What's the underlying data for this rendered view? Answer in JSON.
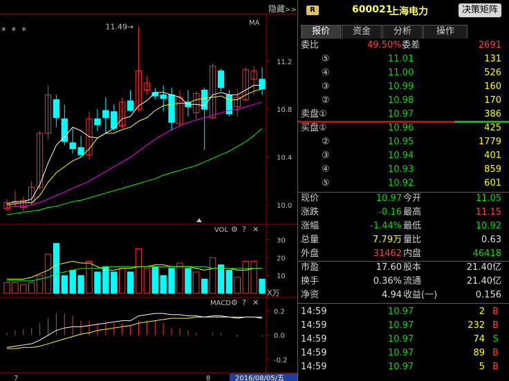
{
  "header": {
    "hide_label": "隐藏",
    "hide_arrow": ">>",
    "r_badge": "R",
    "stock_code": "600021",
    "stock_name": "上海电力",
    "decision_button": "决策矩阵"
  },
  "tabs": [
    {
      "label": "报价",
      "active": true
    },
    {
      "label": "资金",
      "active": false
    },
    {
      "label": "分析",
      "active": false
    },
    {
      "label": "操作",
      "active": false
    }
  ],
  "weibi": {
    "label1": "委比",
    "value1": "49.50%",
    "label2": "委差",
    "value2": "2691"
  },
  "asks": [
    {
      "label": "⑤",
      "price": "11.01",
      "vol": "131"
    },
    {
      "label": "④",
      "price": "11.00",
      "vol": "526"
    },
    {
      "label": "③",
      "price": "10.99",
      "vol": "160"
    },
    {
      "label": "②",
      "price": "10.98",
      "vol": "170"
    },
    {
      "label": "卖盘①",
      "price": "10.97",
      "vol": "386"
    }
  ],
  "bids": [
    {
      "label": "买盘①",
      "price": "10.96",
      "vol": "425"
    },
    {
      "label": "②",
      "price": "10.95",
      "vol": "1779"
    },
    {
      "label": "③",
      "price": "10.94",
      "vol": "401"
    },
    {
      "label": "④",
      "price": "10.93",
      "vol": "859"
    },
    {
      "label": "⑤",
      "price": "10.92",
      "vol": "601"
    }
  ],
  "quote": [
    {
      "l1": "现价",
      "v1": "10.97",
      "c1": "g",
      "l2": "今开",
      "v2": "11.05",
      "c2": "g"
    },
    {
      "l1": "涨跌",
      "v1": "-0.16",
      "c1": "g",
      "l2": "最高",
      "v2": "11.15",
      "c2": "r"
    },
    {
      "l1": "涨幅",
      "v1": "-1.44%",
      "c1": "g",
      "l2": "最低",
      "v2": "10.92",
      "c2": "g"
    },
    {
      "l1": "总量",
      "v1": "7.79万",
      "c1": "y",
      "l2": "量比",
      "v2": "0.63",
      "c2": "w"
    },
    {
      "l1": "外盘",
      "v1": "31462",
      "c1": "r",
      "l2": "内盘",
      "v2": "46418",
      "c2": "g"
    }
  ],
  "fundamentals": [
    {
      "l1": "市盈",
      "v1": "17.60",
      "l2": "股本",
      "v2": "21.40亿"
    },
    {
      "l1": "换手",
      "v1": "0.36%",
      "l2": "流通",
      "v2": "21.40亿"
    },
    {
      "l1": "净资",
      "v1": "4.94",
      "l2": "收益(一)",
      "v2": "0.156"
    }
  ],
  "trades": [
    {
      "time": "14:59",
      "price": "10.97",
      "vol": "2",
      "side": "B"
    },
    {
      "time": "14:59",
      "price": "10.97",
      "vol": "232",
      "side": "B"
    },
    {
      "time": "14:59",
      "price": "10.97",
      "vol": "74",
      "side": "S"
    },
    {
      "time": "14:59",
      "price": "10.97",
      "vol": "89",
      "side": "B"
    },
    {
      "time": "14:59",
      "price": "10.97",
      "vol": "5",
      "side": "B"
    }
  ],
  "chart_header": {
    "stars": "* * *",
    "ma_label": "MA",
    "high_annotation": "11.49"
  },
  "vol_panel": {
    "label": "VOL",
    "unit": "X万",
    "ticks": [
      "30",
      "20",
      "10"
    ]
  },
  "macd_panel": {
    "label": "MACD",
    "ticks": [
      "0.2",
      "0.0",
      "-0.2"
    ]
  },
  "price_ticks": [
    "11.2",
    "10.8",
    "10.4",
    "10.0"
  ],
  "x_axis": {
    "label_a": "7",
    "label_b": "8",
    "date": "2016/08/05/五"
  },
  "colors": {
    "up": "#ff3030",
    "down": "#00ffff",
    "ma5": "#ffffff",
    "ma10": "#ffff00",
    "ma20": "#ff00ff",
    "ma60": "#00ff00"
  },
  "chart_data": {
    "type": "candlestick",
    "price_range": [
      9.88,
      11.55
    ],
    "candles": [
      {
        "o": 9.97,
        "h": 10.05,
        "l": 9.95,
        "c": 10.02
      },
      {
        "o": 10.02,
        "h": 10.12,
        "l": 9.98,
        "c": 10.03
      },
      {
        "o": 9.98,
        "h": 10.07,
        "l": 9.95,
        "c": 10.04
      },
      {
        "o": 10.02,
        "h": 10.2,
        "l": 10.0,
        "c": 10.15
      },
      {
        "o": 10.15,
        "h": 10.62,
        "l": 10.13,
        "c": 10.6
      },
      {
        "o": 10.6,
        "h": 11.0,
        "l": 10.55,
        "c": 10.92
      },
      {
        "o": 10.88,
        "h": 10.92,
        "l": 10.65,
        "c": 10.73
      },
      {
        "o": 10.72,
        "h": 10.84,
        "l": 10.5,
        "c": 10.53
      },
      {
        "o": 10.52,
        "h": 10.64,
        "l": 10.43,
        "c": 10.47
      },
      {
        "o": 10.48,
        "h": 10.58,
        "l": 10.4,
        "c": 10.42
      },
      {
        "o": 10.42,
        "h": 10.78,
        "l": 10.38,
        "c": 10.72
      },
      {
        "o": 10.72,
        "h": 10.8,
        "l": 10.62,
        "c": 10.67
      },
      {
        "o": 10.79,
        "h": 10.9,
        "l": 10.6,
        "c": 10.73
      },
      {
        "o": 10.78,
        "h": 10.84,
        "l": 10.62,
        "c": 10.64
      },
      {
        "o": 10.66,
        "h": 10.9,
        "l": 10.64,
        "c": 10.86
      },
      {
        "o": 10.87,
        "h": 10.96,
        "l": 10.78,
        "c": 10.79
      },
      {
        "o": 10.8,
        "h": 11.49,
        "l": 10.78,
        "c": 11.12
      },
      {
        "o": 10.96,
        "h": 11.08,
        "l": 10.92,
        "c": 11.02
      },
      {
        "o": 10.94,
        "h": 10.98,
        "l": 10.88,
        "c": 10.91
      },
      {
        "o": 10.92,
        "h": 11.0,
        "l": 10.78,
        "c": 10.89
      },
      {
        "o": 10.92,
        "h": 10.98,
        "l": 10.62,
        "c": 10.69
      },
      {
        "o": 10.68,
        "h": 10.96,
        "l": 10.66,
        "c": 10.9
      },
      {
        "o": 10.86,
        "h": 10.96,
        "l": 10.74,
        "c": 10.82
      },
      {
        "o": 10.77,
        "h": 10.95,
        "l": 10.72,
        "c": 10.93
      },
      {
        "o": 10.96,
        "h": 10.98,
        "l": 10.46,
        "c": 10.8
      },
      {
        "o": 10.73,
        "h": 11.18,
        "l": 10.72,
        "c": 11.16
      },
      {
        "o": 11.12,
        "h": 11.14,
        "l": 10.95,
        "c": 10.98
      },
      {
        "o": 10.92,
        "h": 10.96,
        "l": 10.74,
        "c": 10.76
      },
      {
        "o": 10.82,
        "h": 10.96,
        "l": 10.74,
        "c": 10.9
      },
      {
        "o": 10.88,
        "h": 11.15,
        "l": 10.86,
        "c": 11.13
      },
      {
        "o": 11.05,
        "h": 11.16,
        "l": 10.92,
        "c": 11.12
      },
      {
        "o": 11.05,
        "h": 11.15,
        "l": 10.92,
        "c": 10.97
      }
    ],
    "ma5": [
      10.01,
      10.03,
      10.03,
      10.05,
      10.17,
      10.35,
      10.5,
      10.57,
      10.65,
      10.62,
      10.57,
      10.56,
      10.6,
      10.64,
      10.72,
      10.74,
      10.83,
      10.87,
      10.94,
      10.94,
      10.92,
      10.9,
      10.84,
      10.84,
      10.83,
      10.92,
      10.94,
      10.92,
      10.92,
      10.96,
      11.0,
      11.0
    ],
    "ma10": [
      10.0,
      10.01,
      10.02,
      10.02,
      10.08,
      10.19,
      10.27,
      10.32,
      10.37,
      10.4,
      10.47,
      10.56,
      10.6,
      10.6,
      10.63,
      10.65,
      10.7,
      10.73,
      10.79,
      10.83,
      10.84,
      10.85,
      10.85,
      10.88,
      10.89,
      10.9,
      10.91,
      10.88,
      10.88,
      10.92,
      10.95,
      10.97
    ],
    "ma20": [
      9.98,
      9.99,
      9.99,
      10.0,
      10.02,
      10.05,
      10.08,
      10.11,
      10.14,
      10.17,
      10.2,
      10.24,
      10.28,
      10.32,
      10.36,
      10.4,
      10.45,
      10.5,
      10.55,
      10.59,
      10.63,
      10.66,
      10.69,
      10.71,
      10.73,
      10.75,
      10.77,
      10.79,
      10.8,
      10.82,
      10.84,
      10.86
    ],
    "ma60": [
      9.92,
      9.93,
      9.94,
      9.95,
      9.96,
      9.98,
      9.99,
      10.01,
      10.03,
      10.04,
      10.06,
      10.08,
      10.1,
      10.12,
      10.14,
      10.16,
      10.18,
      10.2,
      10.22,
      10.25,
      10.27,
      10.29,
      10.31,
      10.33,
      10.36,
      10.39,
      10.42,
      10.45,
      10.49,
      10.53,
      10.58,
      10.64
    ],
    "volume": [
      6,
      6,
      5,
      6,
      10,
      22,
      28,
      10,
      13,
      10,
      18,
      12,
      15,
      12,
      14,
      12,
      25,
      14,
      15,
      10,
      14,
      17,
      14,
      12,
      8,
      20,
      16,
      13,
      9,
      18,
      18,
      8
    ],
    "vol_range": [
      0,
      36
    ],
    "vol_ma_a": [
      8,
      8,
      8,
      9,
      11,
      13,
      16,
      17,
      18,
      17,
      17,
      15,
      13,
      13,
      14,
      14,
      15,
      15,
      16,
      16,
      15,
      15,
      15,
      14,
      13,
      14,
      14,
      14,
      13,
      13,
      14,
      14
    ],
    "vol_ma_b": [
      7,
      7,
      7,
      7,
      8,
      9,
      11,
      12,
      13,
      14,
      14,
      14,
      15,
      15,
      15,
      15,
      15,
      15,
      15,
      15,
      15,
      15,
      15,
      15,
      15,
      14,
      14,
      14,
      14,
      14,
      14,
      14
    ],
    "macd_range": [
      -0.28,
      0.26
    ],
    "macd_dif": [
      -0.1,
      -0.09,
      -0.08,
      -0.07,
      -0.04,
      0.0,
      0.04,
      0.06,
      0.07,
      0.07,
      0.08,
      0.09,
      0.1,
      0.11,
      0.12,
      0.12,
      0.16,
      0.17,
      0.18,
      0.18,
      0.17,
      0.17,
      0.16,
      0.16,
      0.15,
      0.16,
      0.16,
      0.15,
      0.14,
      0.15,
      0.15,
      0.14
    ],
    "macd_dea": [
      -0.11,
      -0.11,
      -0.1,
      -0.1,
      -0.09,
      -0.07,
      -0.05,
      -0.03,
      -0.01,
      0.01,
      0.02,
      0.04,
      0.05,
      0.06,
      0.07,
      0.08,
      0.1,
      0.11,
      0.12,
      0.13,
      0.14,
      0.14,
      0.14,
      0.15,
      0.15,
      0.15,
      0.15,
      0.15,
      0.15,
      0.15,
      0.15,
      0.15
    ],
    "macd_hist": [
      0.02,
      0.04,
      0.05,
      0.06,
      0.1,
      0.14,
      0.18,
      0.18,
      0.16,
      0.12,
      0.12,
      0.1,
      0.1,
      0.1,
      0.1,
      0.08,
      0.12,
      0.12,
      0.12,
      0.1,
      0.06,
      0.06,
      0.04,
      0.02,
      0.0,
      0.02,
      0.02,
      0.0,
      -0.01,
      0.0,
      0.0,
      -0.01
    ]
  }
}
